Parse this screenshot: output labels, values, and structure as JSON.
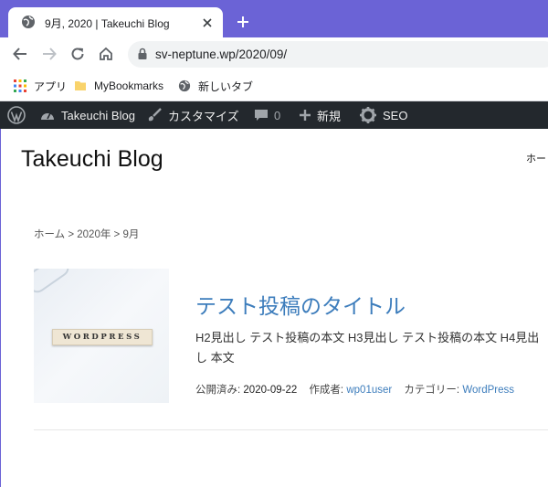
{
  "browser": {
    "tab_title": "9月, 2020 | Takeuchi Blog",
    "url": "sv-neptune.wp/2020/09/",
    "bookmarks": [
      {
        "label": "アプリ",
        "icon": "apps-grid-icon"
      },
      {
        "label": "MyBookmarks",
        "icon": "folder-icon"
      },
      {
        "label": "新しいタブ",
        "icon": "globe-icon"
      }
    ]
  },
  "adminbar": {
    "site_name": "Takeuchi Blog",
    "customize": "カスタマイズ",
    "comments_count": "0",
    "new": "新規",
    "seo": "SEO"
  },
  "site": {
    "title": "Takeuchi Blog",
    "nav_home": "ホー"
  },
  "breadcrumb": {
    "text": "ホーム > 2020年 > 9月"
  },
  "post": {
    "thumbnail_text": "WORDPRESS",
    "title": "テスト投稿のタイトル",
    "excerpt": "H2見出し テスト投稿の本文 H3見出し テスト投稿の本文 H4見出し 本文",
    "published_label": "公開済み:",
    "published_date": "2020-09-22",
    "author_label": "作成者:",
    "author": "wp01user",
    "category_label": "カテゴリー:",
    "category": "WordPress"
  },
  "colors": {
    "accent": "#3d7dbc",
    "frame": "#6b63d6",
    "adminbar": "#23282d"
  }
}
